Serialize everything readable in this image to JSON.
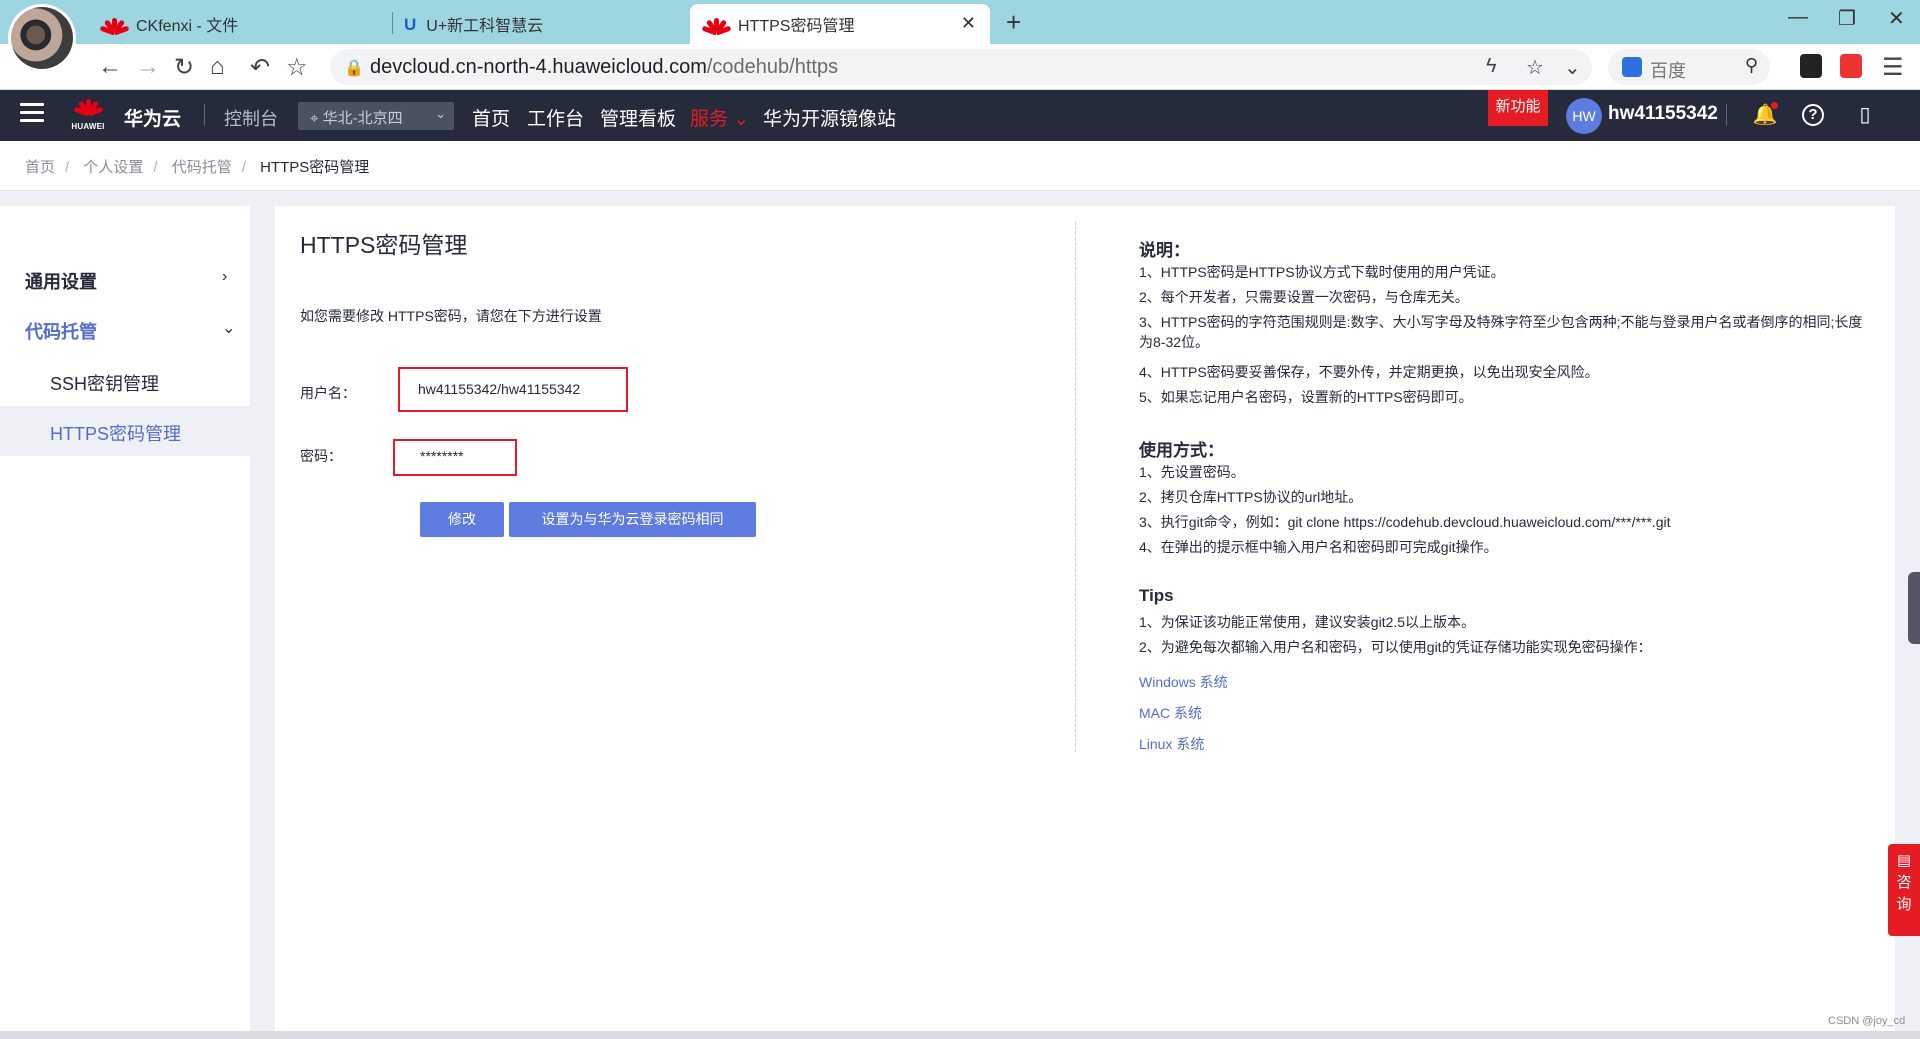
{
  "browser": {
    "tabs": [
      {
        "title": "CKfenxi - 文件"
      },
      {
        "title": "U+新工科智慧云"
      },
      {
        "title": "HTTPS密码管理"
      }
    ],
    "url_host": "devcloud.cn-north-4.huaweicloud.com",
    "url_path": "/codehub/https",
    "search_engine": "百度"
  },
  "header": {
    "logo_text": "HUAWEI",
    "brand": "华为云",
    "console": "控制台",
    "region": "华北-北京四",
    "nav": [
      "首页",
      "工作台",
      "管理看板",
      "服务",
      "华为开源镜像站"
    ],
    "new_feature": "新功能",
    "avatar_initials": "HW",
    "username": "hw41155342"
  },
  "breadcrumb": [
    "首页",
    "个人设置",
    "代码托管",
    "HTTPS密码管理"
  ],
  "sidebar": {
    "groups": [
      {
        "label": "通用设置"
      },
      {
        "label": "代码托管"
      }
    ],
    "items": [
      {
        "label": "SSH密钥管理"
      },
      {
        "label": "HTTPS密码管理"
      }
    ]
  },
  "main": {
    "title": "HTTPS密码管理",
    "hint": "如您需要修改 HTTPS密码，请您在下方进行设置",
    "username_label": "用户名：",
    "username_value": "hw41155342/hw41155342",
    "password_label": "密码：",
    "password_value": "********",
    "modify_button": "修改",
    "same_as_login_button": "设置为与华为云登录密码相同"
  },
  "help": {
    "desc_title": "说明：",
    "desc": [
      "1、HTTPS密码是HTTPS协议方式下载时使用的用户凭证。",
      "2、每个开发者，只需要设置一次密码，与仓库无关。",
      "3、HTTPS密码的字符范围规则是:数字、大小写字母及特殊字符至少包含两种;不能与登录用户名或者倒序的相同;长度为8-32位。",
      "4、HTTPS密码要妥善保存，不要外传，并定期更换，以免出现安全风险。",
      "5、如果忘记用户名密码，设置新的HTTPS密码即可。"
    ],
    "usage_title": "使用方式：",
    "usage": [
      "1、先设置密码。",
      "2、拷贝仓库HTTPS协议的url地址。",
      "3、执行git命令，例如：git clone https://codehub.devcloud.huaweicloud.com/***/***.git",
      "4、在弹出的提示框中输入用户名和密码即可完成git操作。"
    ],
    "tips_title": "Tips",
    "tips": [
      "1、为保证该功能正常使用，建议安装git2.5以上版本。",
      "2、为避免每次都输入用户名和密码，可以使用git的凭证存储功能实现免密码操作："
    ],
    "links": [
      "Windows 系统",
      "MAC 系统",
      "Linux 系统"
    ]
  },
  "consult": "咨询",
  "watermark": "CSDN @joy_cd"
}
